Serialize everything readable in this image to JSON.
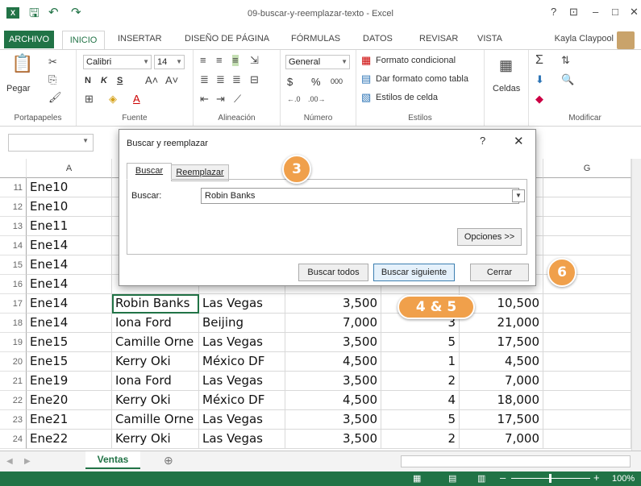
{
  "window": {
    "title": "09-buscar-y-reemplazar-texto - Excel",
    "help": "?",
    "ribbon_opts": "⊡",
    "minimize": "–",
    "maximize": "□",
    "close": "✕"
  },
  "tabs": {
    "file": "ARCHIVO",
    "home": "INICIO",
    "insert": "INSERTAR",
    "layout": "DISEÑO DE PÁGINA",
    "formulas": "FÓRMULAS",
    "data": "DATOS",
    "review": "REVISAR",
    "view": "VISTA",
    "user": "Kayla Claypool"
  },
  "ribbon": {
    "clipboard": {
      "paste": "Pegar",
      "label": "Portapapeles"
    },
    "font": {
      "name": "Calibri",
      "size": "14",
      "bold": "N",
      "italic": "K",
      "underline": "S",
      "label": "Fuente"
    },
    "alignment": {
      "label": "Alineación"
    },
    "number": {
      "format": "General",
      "currency": "$",
      "percent": "%",
      "thousands": "000",
      "label": "Número"
    },
    "styles": {
      "conditional": "Formato condicional",
      "table": "Dar formato como tabla",
      "cell_styles": "Estilos de celda",
      "label": "Estilos"
    },
    "cells": {
      "label": "Celdas"
    },
    "editing": {
      "label": "Modificar"
    }
  },
  "grid": {
    "columns": [
      "A",
      "",
      "",
      "",
      "",
      "",
      "G"
    ],
    "rows": [
      {
        "n": "11",
        "a": "Ene10",
        "b": "",
        "c": "",
        "d": "",
        "e": "",
        "f": ""
      },
      {
        "n": "12",
        "a": "Ene10",
        "b": "",
        "c": "",
        "d": "",
        "e": "",
        "f": ""
      },
      {
        "n": "13",
        "a": "Ene11",
        "b": "",
        "c": "",
        "d": "",
        "e": "",
        "f": ""
      },
      {
        "n": "14",
        "a": "Ene14",
        "b": "",
        "c": "",
        "d": "",
        "e": "",
        "f": ""
      },
      {
        "n": "15",
        "a": "Ene14",
        "b": "",
        "c": "",
        "d": "",
        "e": "",
        "f": ""
      },
      {
        "n": "16",
        "a": "Ene14",
        "b": "",
        "c": "",
        "d": "",
        "e": "",
        "f": ""
      },
      {
        "n": "17",
        "a": "Ene14",
        "b": "Robin Banks",
        "c": "Las Vegas",
        "d": "3,500",
        "e": "",
        "f": "10,500"
      },
      {
        "n": "18",
        "a": "Ene14",
        "b": "Iona Ford",
        "c": "Beijing",
        "d": "7,000",
        "e": "3",
        "f": "21,000"
      },
      {
        "n": "19",
        "a": "Ene15",
        "b": "Camille Orne",
        "c": "Las Vegas",
        "d": "3,500",
        "e": "5",
        "f": "17,500"
      },
      {
        "n": "20",
        "a": "Ene15",
        "b": "Kerry Oki",
        "c": "México DF",
        "d": "4,500",
        "e": "1",
        "f": "4,500"
      },
      {
        "n": "21",
        "a": "Ene19",
        "b": "Iona Ford",
        "c": "Las Vegas",
        "d": "3,500",
        "e": "2",
        "f": "7,000"
      },
      {
        "n": "22",
        "a": "Ene20",
        "b": "Kerry Oki",
        "c": "México DF",
        "d": "4,500",
        "e": "4",
        "f": "18,000"
      },
      {
        "n": "23",
        "a": "Ene21",
        "b": "Camille Orne",
        "c": "Las Vegas",
        "d": "3,500",
        "e": "5",
        "f": "17,500"
      },
      {
        "n": "24",
        "a": "Ene22",
        "b": "Kerry Oki",
        "c": "Las Vegas",
        "d": "3,500",
        "e": "2",
        "f": "7,000"
      }
    ]
  },
  "sheet": {
    "name": "Ventas",
    "add": "⊕"
  },
  "status": {
    "zoom": "100%"
  },
  "dialog": {
    "title": "Buscar y reemplazar",
    "help": "?",
    "close": "✕",
    "tab_find": "Buscar",
    "tab_replace": "Reemplazar",
    "find_label": "Buscar:",
    "find_value": "Robin Banks",
    "options": "Opciones >>",
    "find_all": "Buscar todos",
    "find_next": "Buscar siguiente",
    "close_btn": "Cerrar"
  },
  "callouts": {
    "step3": "3",
    "step45": "4 & 5",
    "step6": "6"
  },
  "colors": {
    "excel_green": "#217346",
    "callout_orange": "#f0a04b"
  }
}
